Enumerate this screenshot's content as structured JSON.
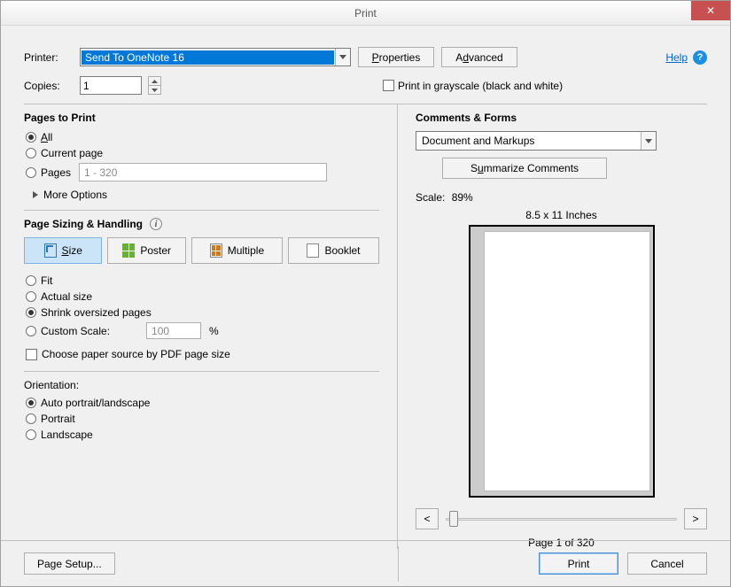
{
  "title": "Print",
  "help": {
    "link": "Help"
  },
  "toolbar": {
    "printer_label": "Printer:",
    "printer_value": "Send To OneNote 16",
    "properties": "Properties",
    "advanced": "Advanced",
    "copies_label": "Copies:",
    "copies_value": "1",
    "grayscale": "Print in grayscale (black and white)"
  },
  "pages": {
    "title": "Pages to Print",
    "all": "All",
    "current": "Current page",
    "pages": "Pages",
    "pages_value": "1 - 320",
    "more": "More Options"
  },
  "sizing": {
    "title": "Page Sizing & Handling",
    "size": "Size",
    "poster": "Poster",
    "multiple": "Multiple",
    "booklet": "Booklet",
    "fit": "Fit",
    "actual": "Actual size",
    "shrink": "Shrink oversized pages",
    "custom": "Custom Scale:",
    "custom_value": "100",
    "percent": "%",
    "choose_paper": "Choose paper source by PDF page size"
  },
  "orientation": {
    "title": "Orientation:",
    "auto": "Auto portrait/landscape",
    "portrait": "Portrait",
    "landscape": "Landscape"
  },
  "comments": {
    "title": "Comments & Forms",
    "value": "Document and Markups",
    "summarize": "Summarize Comments"
  },
  "preview": {
    "scale_label": "Scale:",
    "scale_value": "89%",
    "dimensions": "8.5 x 11 Inches",
    "prev": "<",
    "next": ">",
    "page_of": "Page 1 of 320"
  },
  "footer": {
    "page_setup": "Page Setup...",
    "print": "Print",
    "cancel": "Cancel"
  }
}
